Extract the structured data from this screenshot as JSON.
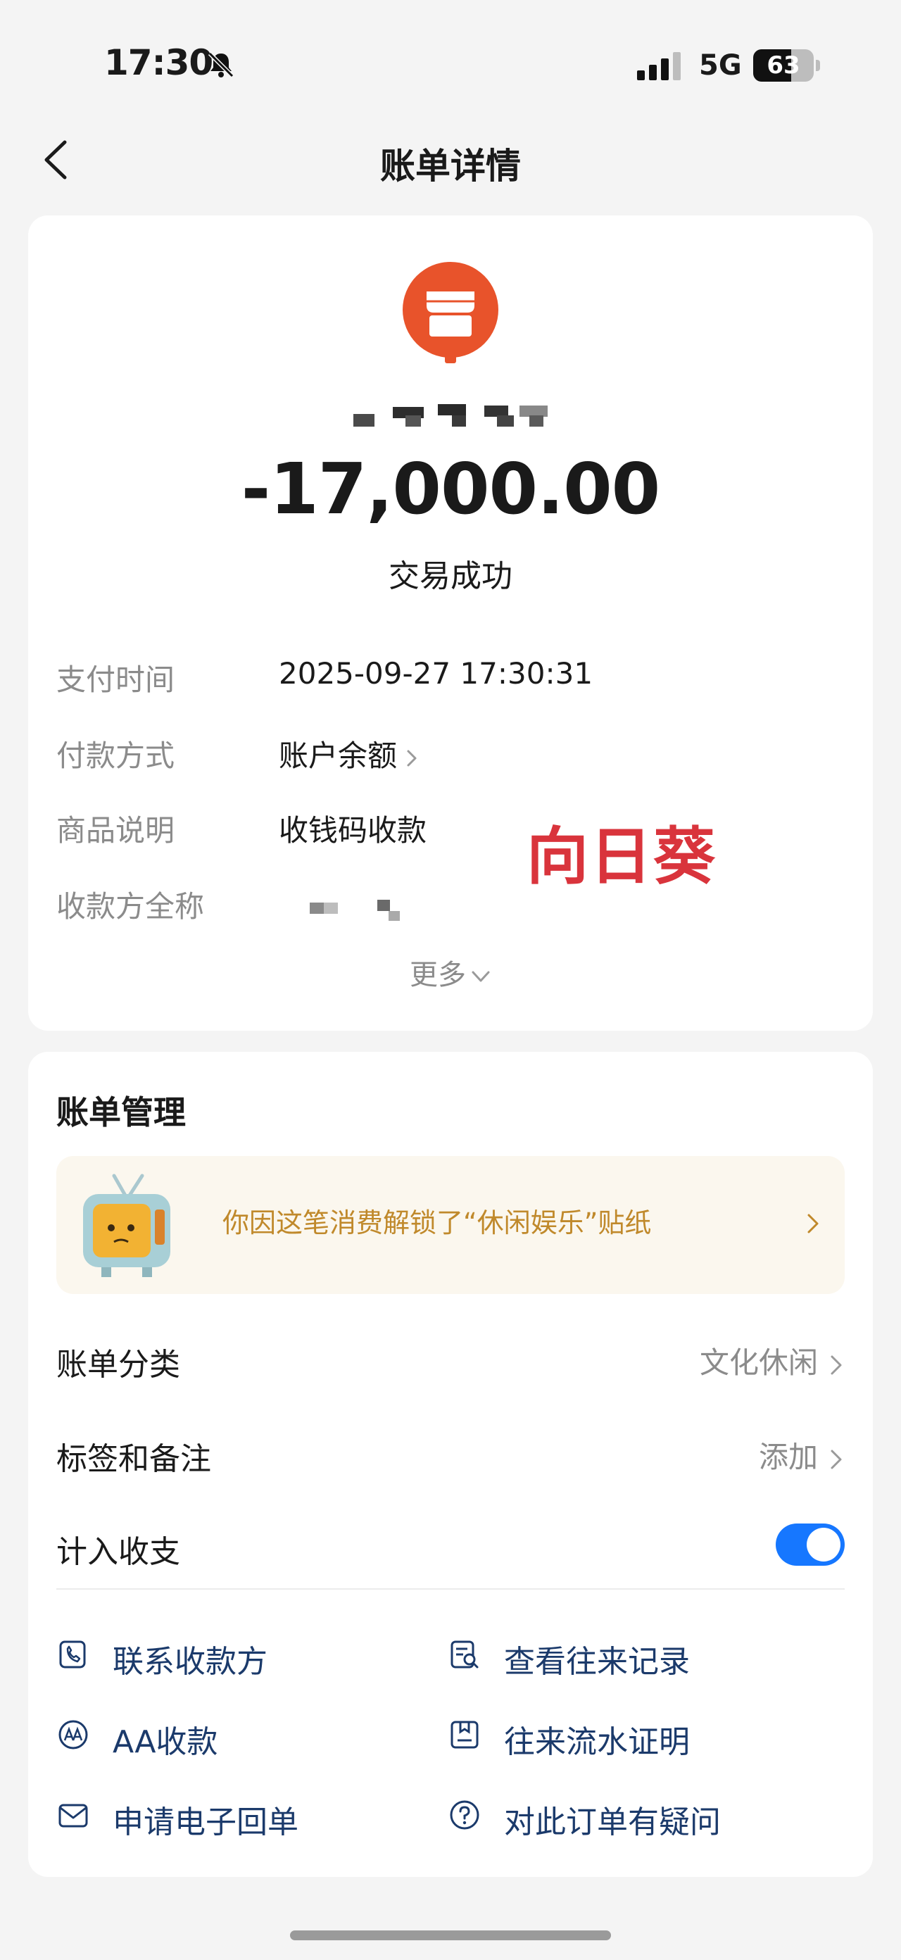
{
  "status_bar": {
    "time": "17:30",
    "network": "5G",
    "battery": "63",
    "battery_level": 0.63
  },
  "nav": {
    "title": "账单详情"
  },
  "transaction": {
    "amount": "-17,000.00",
    "status": "交易成功",
    "rows": [
      {
        "label": "支付时间",
        "value": "2025-09-27 17:30:31"
      },
      {
        "label": "付款方式",
        "value": "账户余额"
      },
      {
        "label": "商品说明",
        "value": "收钱码收款"
      },
      {
        "label": "收款方全称",
        "value": ""
      }
    ],
    "watermark": "向日葵",
    "more_label": "更多"
  },
  "manage": {
    "title": "账单管理",
    "sticker_banner": "你因这笔消费解锁了“休闲娱乐”贴纸",
    "category_label": "账单分类",
    "category_value": "文化休闲",
    "tags_label": "标签和备注",
    "tags_value": "添加",
    "include_label": "计入收支",
    "include_on": true,
    "actions": [
      {
        "label": "联系收款方",
        "icon": "phone-icon"
      },
      {
        "label": "查看往来记录",
        "icon": "record-search-icon"
      },
      {
        "label": "AA收款",
        "icon": "aa-icon"
      },
      {
        "label": "往来流水证明",
        "icon": "statement-icon"
      },
      {
        "label": "申请电子回单",
        "icon": "mail-icon"
      },
      {
        "label": "对此订单有疑问",
        "icon": "question-icon"
      }
    ]
  },
  "colors": {
    "accent": "#1677ff",
    "merchant_orange": "#e8532b",
    "watermark_red": "#d9343c",
    "link_text": "#1b3a6b",
    "banner_text": "#c0892b"
  }
}
